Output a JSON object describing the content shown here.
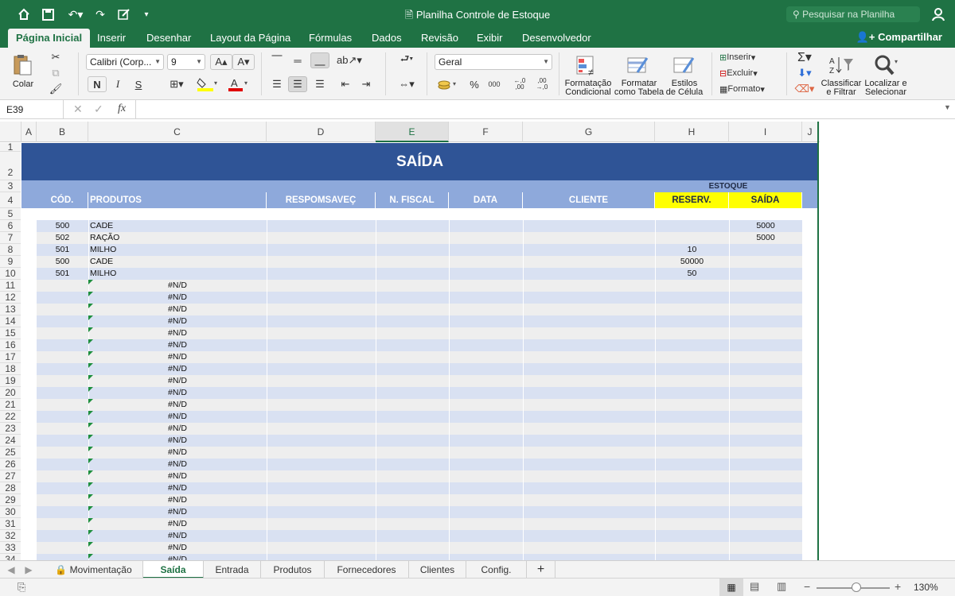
{
  "window": {
    "title": "Planilha Controle de Estoque",
    "search_placeholder": "Pesquisar na Planilha"
  },
  "tabs": [
    "Página Inicial",
    "Inserir",
    "Desenhar",
    "Layout da Página",
    "Fórmulas",
    "Dados",
    "Revisão",
    "Exibir",
    "Desenvolvedor"
  ],
  "share_label": "Compartilhar",
  "ribbon": {
    "paste_label": "Colar",
    "font_name": "Calibri (Corp...",
    "font_size": "9",
    "bold": "N",
    "italic": "I",
    "underline": "S",
    "number_format": "Geral",
    "cond_format_line1": "Formatação",
    "cond_format_line2": "Condicional",
    "table_format_line1": "Formatar",
    "table_format_line2": "como Tabela",
    "cell_styles_line1": "Estilos",
    "cell_styles_line2": "de Célula",
    "insert": "Inserir",
    "delete": "Excluir",
    "format": "Formato",
    "sort_line1": "Classificar",
    "sort_line2": "e Filtrar",
    "find_line1": "Localizar e",
    "find_line2": "Selecionar",
    "percent": "%",
    "thousands": "000",
    "dec_inc": "←,0 ,00",
    "dec_dec": ",00 →,0"
  },
  "formula_bar": {
    "cell_ref": "E39",
    "fx": "fx",
    "value": ""
  },
  "columns": [
    "A",
    "B",
    "C",
    "D",
    "E",
    "F",
    "G",
    "H",
    "I",
    "J"
  ],
  "selected_column": "E",
  "sheet": {
    "title": "SAÍDA",
    "estoque_label": "ESTOQUE",
    "headers": {
      "cod": "CÓD.",
      "produtos": "PRODUTOS",
      "responsavel": "RESPOMSAVEÇ",
      "nfiscal": "N. FISCAL",
      "data": "DATA",
      "cliente": "CLIENTE",
      "reserv": "RESERV.",
      "saida": "SAÍDA"
    },
    "rows": [
      {
        "cod": "500",
        "produto": "CADE",
        "reserv": "",
        "saida": "5000"
      },
      {
        "cod": "502",
        "produto": "RAÇÃO",
        "reserv": "",
        "saida": "5000"
      },
      {
        "cod": "501",
        "produto": "MILHO",
        "reserv": "10",
        "saida": ""
      },
      {
        "cod": "500",
        "produto": "CADE",
        "reserv": "50000",
        "saida": ""
      },
      {
        "cod": "501",
        "produto": "MILHO",
        "reserv": "50",
        "saida": ""
      }
    ],
    "na_value": "#N/D",
    "row_numbers": [
      "1",
      "2",
      "3",
      "4",
      "5",
      "6",
      "7",
      "8",
      "9",
      "10",
      "11",
      "12",
      "13",
      "14",
      "15",
      "16",
      "17",
      "18",
      "19",
      "20",
      "21",
      "22",
      "23",
      "24",
      "25",
      "26",
      "27",
      "28",
      "29",
      "30",
      "31",
      "32",
      "33",
      "34"
    ]
  },
  "sheet_tabs": [
    "Movimentação",
    "Saída",
    "Entrada",
    "Produtos",
    "Fornecedores",
    "Clientes",
    "Config."
  ],
  "active_sheet": "Saída",
  "zoom": "130%",
  "colors": {
    "excel_green": "#1f7244",
    "banner_blue": "#2f5496",
    "header_blue": "#8ea9db",
    "band_light": "#d9e1f2",
    "yellow": "#ffff00"
  }
}
